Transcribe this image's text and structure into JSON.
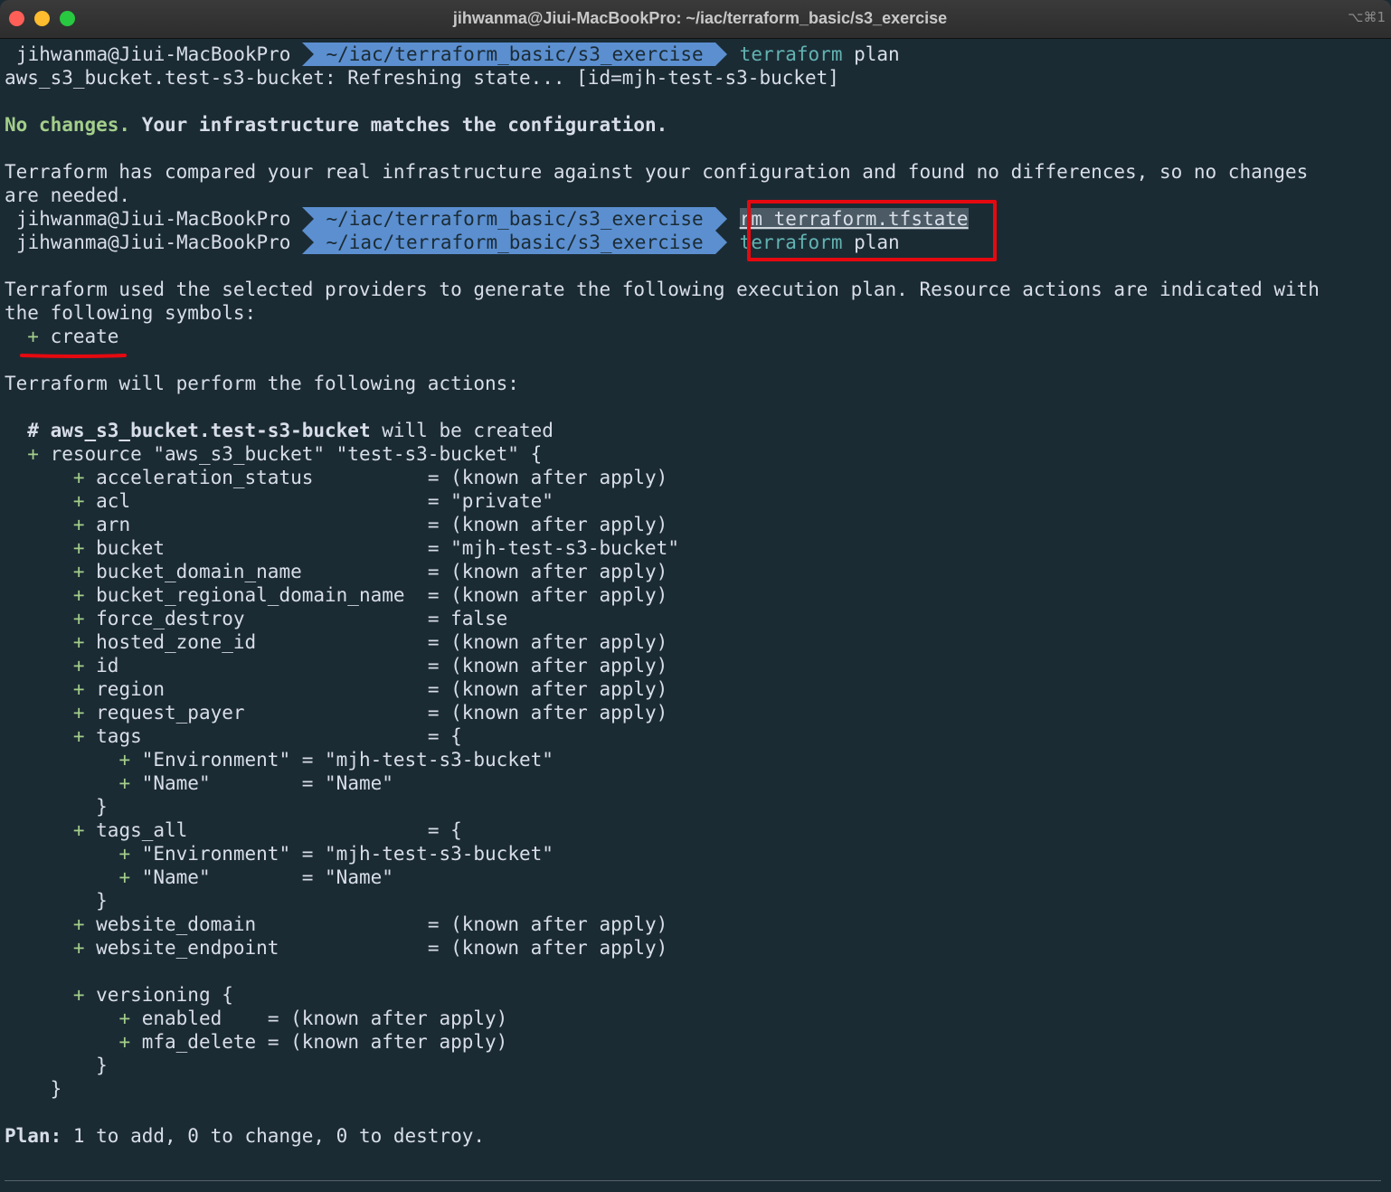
{
  "window": {
    "title": "jihwanma@Jiui-MacBookPro: ~/iac/terraform_basic/s3_exercise",
    "shortcut": "⌥⌘1"
  },
  "prompt": {
    "user": "jihwanma@Jiui-MacBookPro",
    "path": "~/iac/terraform_basic/s3_exercise"
  },
  "commands": {
    "first": [
      "terraform",
      " plan"
    ],
    "rm": "rm terraform.tfstate",
    "second": [
      "terraform",
      " plan"
    ]
  },
  "lines": {
    "refresh": "aws_s3_bucket.test-s3-bucket: Refreshing state... [id=mjh-test-s3-bucket]",
    "no_changes": "No changes.",
    "no_changes_rest": " Your infrastructure matches the configuration.",
    "compared1": "Terraform has compared your real infrastructure against your configuration and found no differences, so no changes",
    "compared2": "are needed.",
    "used1": "Terraform used the selected providers to generate the following execution plan. Resource actions are indicated with",
    "used2": "the following symbols:",
    "create_plus": "  +",
    "create_word": " create",
    "perform": "Terraform will perform the following actions:",
    "res_hash": "  # ",
    "res_name": "aws_s3_bucket.test-s3-bucket",
    "res_will": " will be created",
    "res_plus": "  + ",
    "res_decl": "resource \"aws_s3_bucket\" \"test-s3-bucket\" {",
    "plan_label": "Plan:",
    "plan_rest": " 1 to add, 0 to change, 0 to destroy."
  },
  "attrs": [
    {
      "indent": "      ",
      "name": "acceleration_status          ",
      "value": "= (known after apply)"
    },
    {
      "indent": "      ",
      "name": "acl                          ",
      "value": "= \"private\""
    },
    {
      "indent": "      ",
      "name": "arn                          ",
      "value": "= (known after apply)"
    },
    {
      "indent": "      ",
      "name": "bucket                       ",
      "value": "= \"mjh-test-s3-bucket\""
    },
    {
      "indent": "      ",
      "name": "bucket_domain_name           ",
      "value": "= (known after apply)"
    },
    {
      "indent": "      ",
      "name": "bucket_regional_domain_name  ",
      "value": "= (known after apply)"
    },
    {
      "indent": "      ",
      "name": "force_destroy                ",
      "value": "= false"
    },
    {
      "indent": "      ",
      "name": "hosted_zone_id               ",
      "value": "= (known after apply)"
    },
    {
      "indent": "      ",
      "name": "id                           ",
      "value": "= (known after apply)"
    },
    {
      "indent": "      ",
      "name": "region                       ",
      "value": "= (known after apply)"
    },
    {
      "indent": "      ",
      "name": "request_payer                ",
      "value": "= (known after apply)"
    },
    {
      "indent": "      ",
      "name": "tags                         ",
      "value": "= {"
    },
    {
      "indent": "          ",
      "name": "\"Environment\" ",
      "value": "= \"mjh-test-s3-bucket\""
    },
    {
      "indent": "          ",
      "name": "\"Name\"        ",
      "value": "= \"Name\""
    },
    {
      "indent": "",
      "name": "        }",
      "value": "",
      "noplus": true
    },
    {
      "indent": "      ",
      "name": "tags_all                     ",
      "value": "= {"
    },
    {
      "indent": "          ",
      "name": "\"Environment\" ",
      "value": "= \"mjh-test-s3-bucket\""
    },
    {
      "indent": "          ",
      "name": "\"Name\"        ",
      "value": "= \"Name\""
    },
    {
      "indent": "",
      "name": "        }",
      "value": "",
      "noplus": true
    },
    {
      "indent": "      ",
      "name": "website_domain               ",
      "value": "= (known after apply)"
    },
    {
      "indent": "      ",
      "name": "website_endpoint             ",
      "value": "= (known after apply)"
    },
    {
      "indent": "",
      "name": "",
      "value": "",
      "noplus": true
    },
    {
      "indent": "      ",
      "name": "versioning {",
      "value": ""
    },
    {
      "indent": "          ",
      "name": "enabled    ",
      "value": "= (known after apply)"
    },
    {
      "indent": "          ",
      "name": "mfa_delete ",
      "value": "= (known after apply)"
    },
    {
      "indent": "",
      "name": "        }",
      "value": "",
      "noplus": true
    },
    {
      "indent": "",
      "name": "    }",
      "value": "",
      "noplus": true
    }
  ],
  "colors": {
    "background": "#1b2b34",
    "path_segment": "#5b8fd0",
    "highlight_box": "#e5090f",
    "green": "#a3cf8a"
  }
}
